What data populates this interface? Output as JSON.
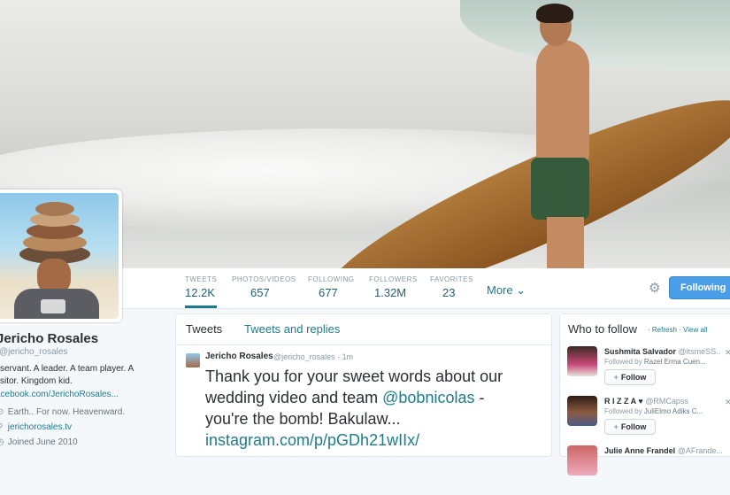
{
  "profile": {
    "name": "Jericho Rosales",
    "handle": "@jericho_rosales",
    "bio": "servant. A leader. A team player. A",
    "bio2": "sitor. Kingdom kid.",
    "facebook": "acebook.com/JerichoRosales...",
    "location": "Earth.. For now. Heavenward.",
    "website": "jerichorosales.tv",
    "joined": "Joined June 2010"
  },
  "stats": [
    {
      "label": "TWEETS",
      "value": "12.2K"
    },
    {
      "label": "PHOTOS/VIDEOS",
      "value": "657"
    },
    {
      "label": "FOLLOWING",
      "value": "677"
    },
    {
      "label": "FOLLOWERS",
      "value": "1.32M"
    },
    {
      "label": "FAVORITES",
      "value": "23"
    }
  ],
  "more_label": "More",
  "following_label": "Following",
  "tabs": {
    "tweets": "Tweets",
    "replies": "Tweets and replies"
  },
  "tweet": {
    "name": "Jericho Rosales",
    "handle": "@jericho_rosales · 1m",
    "text1": "Thank you for your sweet words about our",
    "text2": "wedding video and team ",
    "mention": "@bobnicolas",
    "text3": " -",
    "text4": "you're the bomb! Bakulaw...",
    "url": "instagram.com/p/pGDh21wIIx/"
  },
  "who_to_follow": {
    "title": "Who to follow",
    "refresh": "· Refresh",
    "view_all": "· View all",
    "suggestions": [
      {
        "name": "Sushmita Salvador",
        "handle": "@itsmeSS..",
        "followed_by_prefix": "Followed by ",
        "followed_by": "Razel Erma Cuen...",
        "button": "Follow"
      },
      {
        "name": "R I Z Z A ♥",
        "handle": "@RMCapss",
        "followed_by_prefix": "Followed by ",
        "followed_by": "JuliElmo Adiks C...",
        "button": "Follow"
      },
      {
        "name": "Julie Anne Frandel",
        "handle": "@AFrande...",
        "followed_by_prefix": "",
        "followed_by": "",
        "button": ""
      }
    ]
  },
  "colors": {
    "accent": "#1e7b8c",
    "follow_button": "#4a9ee8"
  },
  "icons": {
    "location": "map-pin-icon",
    "website": "link-icon",
    "joined": "calendar-icon",
    "gear": "gear-icon"
  }
}
